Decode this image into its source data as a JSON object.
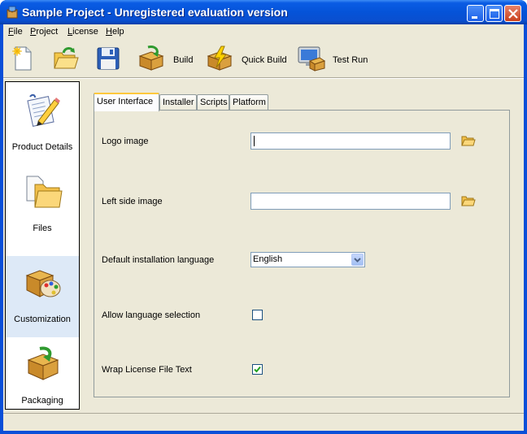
{
  "window": {
    "title": "Sample Project - Unregistered evaluation version"
  },
  "menu": {
    "items": [
      {
        "label": "File",
        "mnemonic": "F",
        "rest": "ile"
      },
      {
        "label": "Project",
        "mnemonic": "P",
        "rest": "roject"
      },
      {
        "label": "License",
        "mnemonic": "L",
        "rest": "icense"
      },
      {
        "label": "Help",
        "mnemonic": "H",
        "rest": "elp"
      }
    ]
  },
  "toolbar": {
    "new_icon": "new-document-icon",
    "open_icon": "open-folder-icon",
    "save_icon": "floppy-disk-icon",
    "build_label": "Build",
    "quick_build_label": "Quick Build",
    "test_run_label": "Test Run"
  },
  "sidebar": {
    "items": [
      {
        "label": "Product Details",
        "icon": "document-pencil-icon",
        "active": false
      },
      {
        "label": "Files",
        "icon": "files-folder-icon",
        "active": false
      },
      {
        "label": "Customization",
        "icon": "box-palette-icon",
        "active": true
      },
      {
        "label": "Packaging",
        "icon": "package-box-icon",
        "active": false
      }
    ]
  },
  "tabs": [
    {
      "label": "User Interface",
      "active": true
    },
    {
      "label": "Installer",
      "active": false
    },
    {
      "label": "Scripts",
      "active": false
    },
    {
      "label": "Platform",
      "active": false
    }
  ],
  "form": {
    "logo_image_label": "Logo image",
    "logo_image_value": "",
    "left_side_image_label": "Left side image",
    "left_side_image_value": "",
    "default_language_label": "Default installation language",
    "default_language_value": "English",
    "allow_language_selection_label": "Allow language selection",
    "allow_language_selection_checked": false,
    "wrap_license_label": "Wrap License File Text",
    "wrap_license_checked": true
  },
  "status": {
    "text": ""
  },
  "colors": {
    "titlebar": "#0553d8",
    "face": "#ece9d8",
    "active_nav": "#dde9f7",
    "tab_highlight": "#ffc83c"
  }
}
